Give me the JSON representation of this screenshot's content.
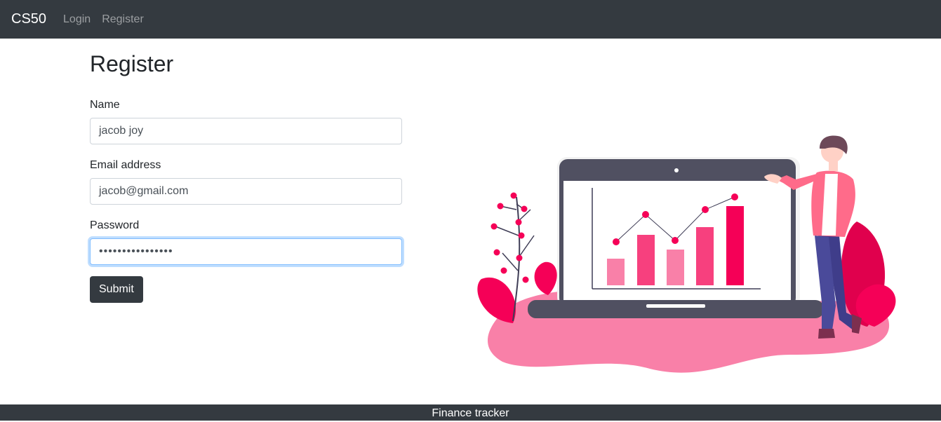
{
  "navbar": {
    "brand": "CS50",
    "links": [
      "Login",
      "Register"
    ]
  },
  "page": {
    "title": "Register"
  },
  "form": {
    "name_label": "Name",
    "name_value": "jacob joy",
    "email_label": "Email address",
    "email_value": "jacob@gmail.com",
    "password_label": "Password",
    "password_value": "••••••••••••••••",
    "submit_label": "Submit"
  },
  "footer": {
    "text": "Finance tracker"
  },
  "colors": {
    "navbar_bg": "#343a40",
    "accent_pink": "#f50057",
    "blob_pink": "#f980a8",
    "laptop_dark": "#505061"
  }
}
